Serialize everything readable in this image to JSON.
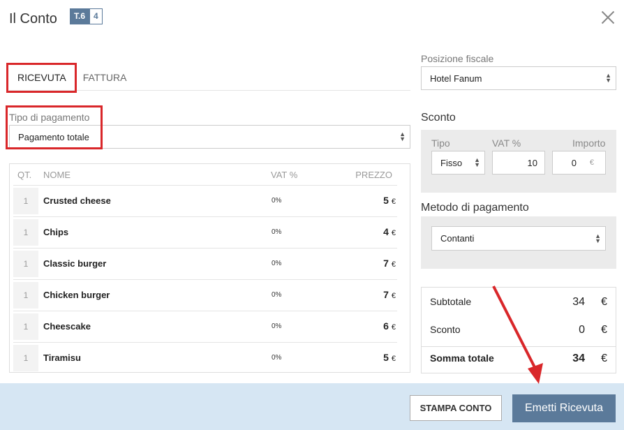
{
  "header": {
    "title": "Il Conto",
    "table_badge": "T.6",
    "table_count": "4"
  },
  "tabs": [
    {
      "label": "RICEVUTA"
    },
    {
      "label": "FATTURA"
    }
  ],
  "payment_type": {
    "label": "Tipo di pagamento",
    "value": "Pagamento totale"
  },
  "items": {
    "headers": {
      "qty": "QT.",
      "name": "NOME",
      "vat": "VAT %",
      "price": "PREZZO"
    },
    "rows": [
      {
        "qty": "1",
        "name": "Crusted cheese",
        "vat": "0%",
        "price": "5",
        "currency": "€"
      },
      {
        "qty": "1",
        "name": "Chips",
        "vat": "0%",
        "price": "4",
        "currency": "€"
      },
      {
        "qty": "1",
        "name": "Classic burger",
        "vat": "0%",
        "price": "7",
        "currency": "€"
      },
      {
        "qty": "1",
        "name": "Chicken burger",
        "vat": "0%",
        "price": "7",
        "currency": "€"
      },
      {
        "qty": "1",
        "name": "Cheescake",
        "vat": "0%",
        "price": "6",
        "currency": "€"
      },
      {
        "qty": "1",
        "name": "Tiramisu",
        "vat": "0%",
        "price": "5",
        "currency": "€"
      }
    ]
  },
  "fiscal_position": {
    "label": "Posizione fiscale",
    "value": "Hotel Fanum"
  },
  "discount": {
    "title": "Sconto",
    "type_label": "Tipo",
    "type_value": "Fisso",
    "vat_label": "VAT %",
    "vat_value": "10",
    "amount_label": "Importo",
    "amount_value": "0",
    "amount_currency": "€"
  },
  "payment_method": {
    "title": "Metodo di pagamento",
    "value": "Contanti"
  },
  "totals": {
    "subtotal_label": "Subtotale",
    "subtotal_value": "34",
    "subtotal_currency": "€",
    "discount_label": "Sconto",
    "discount_value": "0",
    "discount_currency": "€",
    "total_label": "Somma totale",
    "total_value": "34",
    "total_currency": "€"
  },
  "footer": {
    "print_label": "STAMPA CONTO",
    "emit_label": "Emetti Ricevuta"
  },
  "colors": {
    "accent": "#5b7a9a",
    "annotation_red": "#d9272a",
    "footer_bg": "#d6e6f3"
  }
}
